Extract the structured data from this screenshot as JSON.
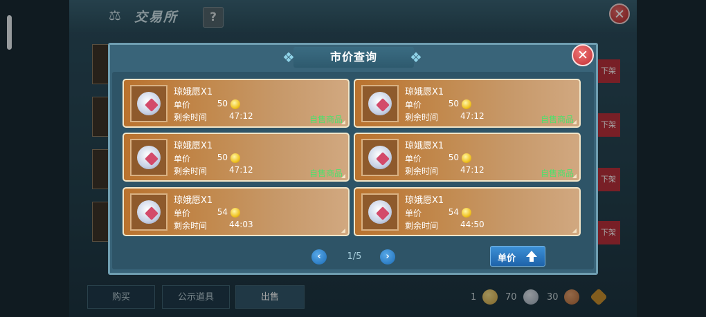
{
  "background": {
    "title": "交易所",
    "help_icon": "?",
    "close_icon": "close-icon",
    "delist_label": "下架",
    "tabs": [
      "购买",
      "公示道具",
      "出售"
    ],
    "active_tab": "出售",
    "currencies": [
      {
        "amount": "1",
        "color": "#c8a043"
      },
      {
        "amount": "70",
        "color": "#9aa8b6"
      },
      {
        "amount": "30",
        "color": "#b06a3a"
      }
    ]
  },
  "modal": {
    "title": "市价查询",
    "price_label": "单价",
    "time_label": "剩余时间",
    "listings": [
      {
        "name": "琼娥愿X1",
        "price": "50",
        "time": "47:12",
        "tag": "自售商品"
      },
      {
        "name": "琼娥愿X1",
        "price": "50",
        "time": "47:12",
        "tag": "自售商品"
      },
      {
        "name": "琼娥愿X1",
        "price": "50",
        "time": "47:12",
        "tag": "自售商品"
      },
      {
        "name": "琼娥愿X1",
        "price": "50",
        "time": "47:12",
        "tag": "自售商品"
      },
      {
        "name": "琼娥愿X1",
        "price": "54",
        "time": "44:03",
        "tag": ""
      },
      {
        "name": "琼娥愿X1",
        "price": "54",
        "time": "44:50",
        "tag": ""
      }
    ],
    "pagination": {
      "page": "1/5"
    },
    "sort_button": "单价"
  },
  "colors": {
    "accent_blue": "#1e63aa",
    "card_tan": "#c28a4f",
    "tag_green": "#4fe06c",
    "close_red": "#c22f35"
  }
}
